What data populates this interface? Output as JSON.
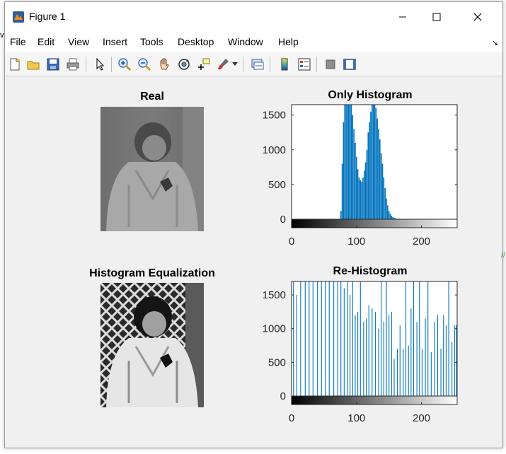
{
  "window": {
    "title": "Figure 1",
    "controls": {
      "minimize": "—",
      "maximize": "☐",
      "close": "✕"
    }
  },
  "menu": [
    "File",
    "Edit",
    "View",
    "Insert",
    "Tools",
    "Desktop",
    "Window",
    "Help"
  ],
  "toolbar": {
    "icons": [
      "new-figure-icon",
      "open-file-icon",
      "save-icon",
      "print-icon",
      "pointer-icon",
      "zoom-in-icon",
      "zoom-out-icon",
      "pan-hand-icon",
      "rotate-3d-icon",
      "data-cursor-icon",
      "brush-icon",
      "link-plot-icon",
      "colorbar-icon",
      "legend-icon",
      "hide-plot-tools-icon",
      "show-plot-tools-icon"
    ]
  },
  "panels": {
    "real": {
      "title": "Real"
    },
    "equalized": {
      "title": "Histogram Equalization"
    },
    "hist1": {
      "title": "Only Histogram"
    },
    "hist2": {
      "title": "Re-Histogram"
    }
  },
  "chart_data": [
    {
      "type": "bar",
      "title": "Only Histogram",
      "xlim": [
        0,
        255
      ],
      "ylim": [
        0,
        1650
      ],
      "xticks": [
        0,
        100,
        200
      ],
      "yticks": [
        0,
        500,
        1000,
        1500
      ],
      "series_color": "#0072bd",
      "x": [
        76,
        78,
        80,
        82,
        84,
        86,
        88,
        90,
        92,
        94,
        96,
        98,
        100,
        102,
        104,
        106,
        108,
        110,
        112,
        114,
        116,
        118,
        120,
        122,
        124,
        126,
        128,
        130,
        132,
        134,
        136,
        138,
        140,
        142,
        144,
        146,
        148,
        150,
        152,
        154,
        156,
        158,
        160,
        165,
        170
      ],
      "values": [
        120,
        800,
        1400,
        1650,
        1650,
        1650,
        1650,
        1650,
        1650,
        1500,
        1300,
        1100,
        900,
        720,
        600,
        560,
        540,
        600,
        700,
        820,
        1000,
        1250,
        1400,
        1550,
        1650,
        1650,
        1650,
        1600,
        1450,
        1300,
        1150,
        950,
        800,
        600,
        450,
        300,
        200,
        120,
        80,
        50,
        30,
        20,
        15,
        8,
        4
      ]
    },
    {
      "type": "bar",
      "title": "Re-Histogram",
      "xlim": [
        0,
        255
      ],
      "ylim": [
        0,
        1700
      ],
      "xticks": [
        0,
        100,
        200
      ],
      "yticks": [
        0,
        500,
        1000,
        1500
      ],
      "series_color": "#0072bd",
      "x": [
        3,
        8,
        14,
        21,
        27,
        33,
        40,
        46,
        52,
        58,
        65,
        71,
        76,
        81,
        86,
        90,
        94,
        98,
        102,
        106,
        111,
        115,
        119,
        124,
        129,
        134,
        138,
        142,
        146,
        150,
        154,
        158,
        163,
        167,
        172,
        176,
        180,
        184,
        188,
        193,
        197,
        201,
        206,
        210,
        215,
        220,
        225,
        230,
        234,
        238,
        242,
        247,
        251,
        254
      ],
      "values": [
        1700,
        1500,
        1700,
        1700,
        1700,
        1700,
        1700,
        1700,
        1700,
        1700,
        1700,
        1700,
        1700,
        1600,
        1700,
        1500,
        1700,
        1200,
        1250,
        1700,
        1100,
        1150,
        1350,
        1300,
        1250,
        1000,
        1700,
        1100,
        1700,
        1200,
        1250,
        550,
        700,
        1050,
        700,
        1700,
        750,
        1300,
        1700,
        1100,
        1700,
        700,
        1150,
        1700,
        650,
        1100,
        1200,
        700,
        1200,
        1050,
        1700,
        800,
        1050,
        1050
      ]
    }
  ]
}
